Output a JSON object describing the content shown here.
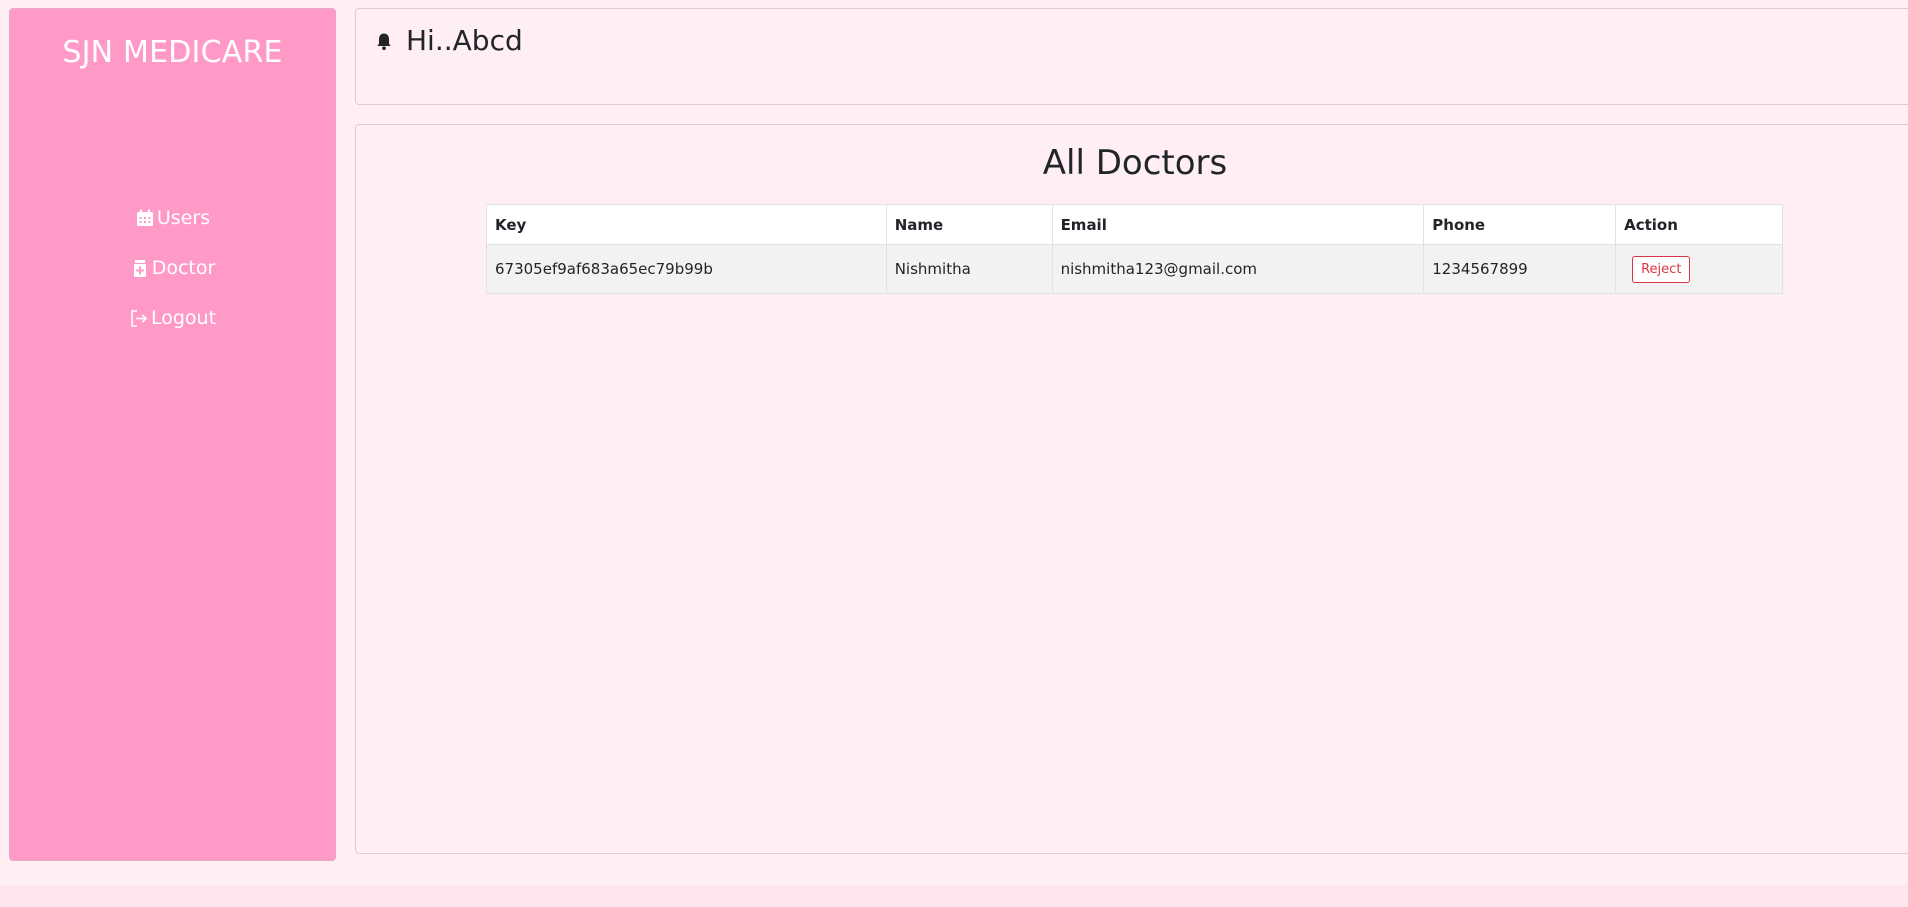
{
  "sidebar": {
    "brand": "SJN MEDICARE",
    "items": [
      {
        "label": "Users",
        "icon": "calendar-icon"
      },
      {
        "label": "Doctor",
        "icon": "medical-icon"
      },
      {
        "label": "Logout",
        "icon": "logout-icon"
      }
    ]
  },
  "header": {
    "greeting": "Hi..Abcd",
    "icon": "bell-icon"
  },
  "main": {
    "title": "All Doctors",
    "table": {
      "columns": [
        "Key",
        "Name",
        "Email",
        "Phone",
        "Action"
      ],
      "rows": [
        {
          "key": "67305ef9af683a65ec79b99b",
          "name": "Nishmitha",
          "email": "nishmitha123@gmail.com",
          "phone": "1234567899",
          "action": "Reject"
        }
      ]
    }
  },
  "colors": {
    "sidebar_bg": "#ff99c8",
    "page_bg": "#ffeef2",
    "danger": "#dc3545"
  }
}
